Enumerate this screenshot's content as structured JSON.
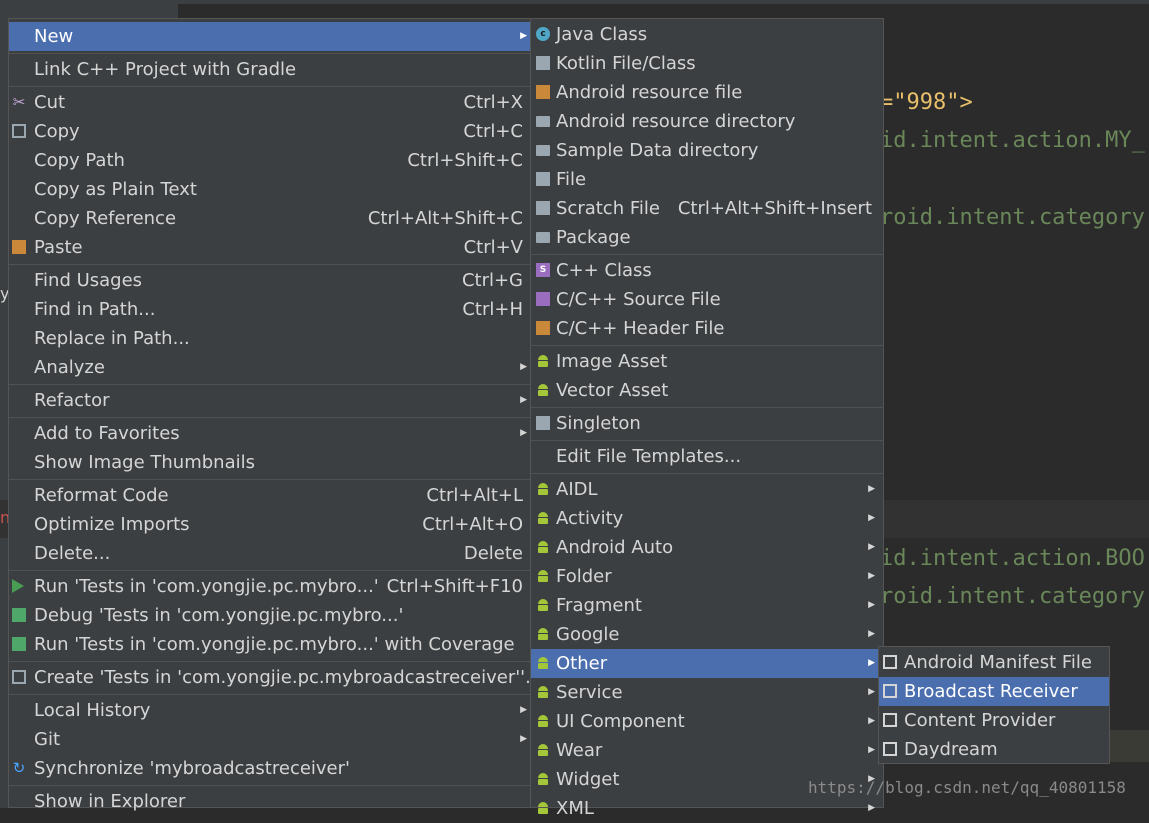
{
  "editor": {
    "lines": [
      {
        "text": "=\"998\">",
        "color": "#e8bf6a"
      },
      {
        "text": "id.intent.action.MY_",
        "color": "#6a8759"
      },
      {
        "text": "roid.intent.category",
        "color": "#6a8759"
      },
      {
        "text": "id.intent.action.BOO",
        "color": "#6a8759"
      },
      {
        "text": "roid.intent.category",
        "color": "#6a8759"
      }
    ],
    "side_fragments": [
      "y",
      "n"
    ]
  },
  "watermark": "https://blog.csdn.net/qq_40801158",
  "context_menu": {
    "items": [
      {
        "label": "New",
        "shortcut": "",
        "submenu": true,
        "selected": true,
        "icon": ""
      },
      {
        "label": "Link C++ Project with Gradle",
        "shortcut": "",
        "submenu": false,
        "icon": ""
      },
      {
        "label": "Cut",
        "shortcut": "Ctrl+X",
        "submenu": false,
        "icon": "scissors-icon"
      },
      {
        "label": "Copy",
        "shortcut": "Ctrl+C",
        "submenu": false,
        "icon": "copy-icon"
      },
      {
        "label": "Copy Path",
        "shortcut": "Ctrl+Shift+C",
        "submenu": false,
        "icon": ""
      },
      {
        "label": "Copy as Plain Text",
        "shortcut": "",
        "submenu": false,
        "icon": ""
      },
      {
        "label": "Copy Reference",
        "shortcut": "Ctrl+Alt+Shift+C",
        "submenu": false,
        "icon": ""
      },
      {
        "label": "Paste",
        "shortcut": "Ctrl+V",
        "submenu": false,
        "icon": "paste-icon"
      },
      {
        "label": "Find Usages",
        "shortcut": "Ctrl+G",
        "submenu": false,
        "icon": ""
      },
      {
        "label": "Find in Path...",
        "shortcut": "Ctrl+H",
        "submenu": false,
        "icon": ""
      },
      {
        "label": "Replace in Path...",
        "shortcut": "",
        "submenu": false,
        "icon": ""
      },
      {
        "label": "Analyze",
        "shortcut": "",
        "submenu": true,
        "icon": ""
      },
      {
        "label": "Refactor",
        "shortcut": "",
        "submenu": true,
        "icon": ""
      },
      {
        "label": "Add to Favorites",
        "shortcut": "",
        "submenu": true,
        "icon": ""
      },
      {
        "label": "Show Image Thumbnails",
        "shortcut": "",
        "submenu": false,
        "icon": ""
      },
      {
        "label": "Reformat Code",
        "shortcut": "Ctrl+Alt+L",
        "submenu": false,
        "icon": ""
      },
      {
        "label": "Optimize Imports",
        "shortcut": "Ctrl+Alt+O",
        "submenu": false,
        "icon": ""
      },
      {
        "label": "Delete...",
        "shortcut": "Delete",
        "submenu": false,
        "icon": ""
      },
      {
        "label": "Run 'Tests in 'com.yongjie.pc.mybro...'",
        "shortcut": "Ctrl+Shift+F10",
        "submenu": false,
        "icon": "run-icon"
      },
      {
        "label": "Debug 'Tests in 'com.yongjie.pc.mybro...'",
        "shortcut": "",
        "submenu": false,
        "icon": "debug-icon"
      },
      {
        "label": "Run 'Tests in 'com.yongjie.pc.mybro...' with Coverage",
        "shortcut": "",
        "submenu": false,
        "icon": "coverage-icon"
      },
      {
        "label": "Create 'Tests in 'com.yongjie.pc.mybroadcastreceiver''...",
        "shortcut": "",
        "submenu": false,
        "icon": "create-config-icon"
      },
      {
        "label": "Local History",
        "shortcut": "",
        "submenu": true,
        "icon": ""
      },
      {
        "label": "Git",
        "shortcut": "",
        "submenu": true,
        "icon": ""
      },
      {
        "label": "Synchronize 'mybroadcastreceiver'",
        "shortcut": "",
        "submenu": false,
        "icon": "sync-icon"
      },
      {
        "label": "Show in Explorer",
        "shortcut": "",
        "submenu": false,
        "icon": ""
      }
    ]
  },
  "new_submenu": {
    "items": [
      {
        "label": "Java Class",
        "shortcut": "",
        "submenu": false,
        "icon": "java-class-icon"
      },
      {
        "label": "Kotlin File/Class",
        "shortcut": "",
        "submenu": false,
        "icon": "kotlin-file-icon"
      },
      {
        "label": "Android resource file",
        "shortcut": "",
        "submenu": false,
        "icon": "resource-file-icon"
      },
      {
        "label": "Android resource directory",
        "shortcut": "",
        "submenu": false,
        "icon": "folder-icon"
      },
      {
        "label": "Sample Data directory",
        "shortcut": "",
        "submenu": false,
        "icon": "folder-icon"
      },
      {
        "label": "File",
        "shortcut": "",
        "submenu": false,
        "icon": "file-icon"
      },
      {
        "label": "Scratch File",
        "shortcut": "Ctrl+Alt+Shift+Insert",
        "submenu": false,
        "icon": "scratch-file-icon"
      },
      {
        "label": "Package",
        "shortcut": "",
        "submenu": false,
        "icon": "package-icon"
      },
      {
        "label": "C++ Class",
        "shortcut": "",
        "submenu": false,
        "icon": "cpp-class-icon"
      },
      {
        "label": "C/C++ Source File",
        "shortcut": "",
        "submenu": false,
        "icon": "cpp-source-icon"
      },
      {
        "label": "C/C++ Header File",
        "shortcut": "",
        "submenu": false,
        "icon": "cpp-header-icon"
      },
      {
        "label": "Image Asset",
        "shortcut": "",
        "submenu": false,
        "icon": "android-icon"
      },
      {
        "label": "Vector Asset",
        "shortcut": "",
        "submenu": false,
        "icon": "android-icon"
      },
      {
        "label": "Singleton",
        "shortcut": "",
        "submenu": false,
        "icon": "singleton-icon"
      },
      {
        "label": "Edit File Templates...",
        "shortcut": "",
        "submenu": false,
        "icon": ""
      },
      {
        "label": "AIDL",
        "shortcut": "",
        "submenu": true,
        "icon": "android-icon"
      },
      {
        "label": "Activity",
        "shortcut": "",
        "submenu": true,
        "icon": "android-icon"
      },
      {
        "label": "Android Auto",
        "shortcut": "",
        "submenu": true,
        "icon": "android-icon"
      },
      {
        "label": "Folder",
        "shortcut": "",
        "submenu": true,
        "icon": "android-icon"
      },
      {
        "label": "Fragment",
        "shortcut": "",
        "submenu": true,
        "icon": "android-icon"
      },
      {
        "label": "Google",
        "shortcut": "",
        "submenu": true,
        "icon": "android-icon"
      },
      {
        "label": "Other",
        "shortcut": "",
        "submenu": true,
        "selected": true,
        "icon": "android-icon"
      },
      {
        "label": "Service",
        "shortcut": "",
        "submenu": true,
        "icon": "android-icon"
      },
      {
        "label": "UI Component",
        "shortcut": "",
        "submenu": true,
        "icon": "android-icon"
      },
      {
        "label": "Wear",
        "shortcut": "",
        "submenu": true,
        "icon": "android-icon"
      },
      {
        "label": "Widget",
        "shortcut": "",
        "submenu": true,
        "icon": "android-icon"
      },
      {
        "label": "XML",
        "shortcut": "",
        "submenu": true,
        "icon": "android-icon"
      }
    ]
  },
  "other_submenu": {
    "items": [
      {
        "label": "Android Manifest File",
        "selected": false,
        "icon": "android-file-icon"
      },
      {
        "label": "Broadcast Receiver",
        "selected": true,
        "icon": "android-file-icon"
      },
      {
        "label": "Content Provider",
        "selected": false,
        "icon": "android-file-icon"
      },
      {
        "label": "Daydream",
        "selected": false,
        "icon": "android-file-icon"
      }
    ]
  },
  "colors": {
    "selection": "#4b6eaf",
    "menu_bg": "#3c3f41",
    "android_green": "#a4c639"
  }
}
